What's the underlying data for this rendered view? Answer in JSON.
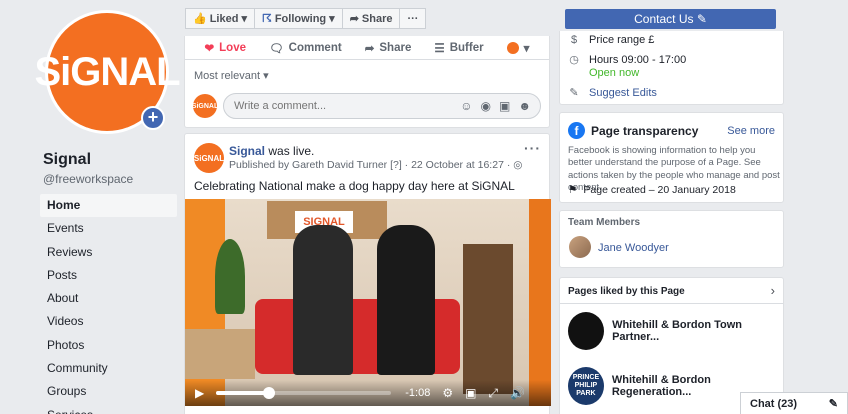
{
  "profile": {
    "logo_text": "SiGNAL",
    "name": "Signal",
    "handle": "@freeworkspace"
  },
  "nav": {
    "items": [
      {
        "label": "Home",
        "active": true
      },
      {
        "label": "Events"
      },
      {
        "label": "Reviews"
      },
      {
        "label": "Posts"
      },
      {
        "label": "About"
      },
      {
        "label": "Videos"
      },
      {
        "label": "Photos"
      },
      {
        "label": "Community"
      },
      {
        "label": "Groups"
      },
      {
        "label": "Services"
      }
    ]
  },
  "action_bar": {
    "liked": "Liked",
    "following": "Following",
    "share": "Share",
    "more": "···"
  },
  "top_post": {
    "love": "Love",
    "comment": "Comment",
    "share": "Share",
    "buffer": "Buffer",
    "sort": "Most relevant",
    "comment_placeholder": "Write a comment..."
  },
  "post": {
    "author": "Signal",
    "author_suffix": "was live.",
    "meta": "Published by Gareth David Turner [?] · 22 October at 16:27 · ◎",
    "text": "Celebrating National make a dog happy day here at SiGNAL",
    "video_sign": "SIGNAL",
    "video": {
      "progress": 0.3,
      "time_remaining": "-1:08"
    }
  },
  "right": {
    "contact_button": "Contact Us ✎",
    "price_range": "Price range £",
    "hours": "Hours 09:00 - 17:00",
    "open_now": "Open now",
    "suggest_edits": "Suggest Edits",
    "transparency": {
      "title": "Page transparency",
      "see_more": "See more",
      "description": "Facebook is showing information to help you better understand the purpose of a Page. See actions taken by the people who manage and post content.",
      "created": "Page created – 20 January 2018"
    },
    "team": {
      "title": "Team Members",
      "member": "Jane Woodyer"
    },
    "liked_pages": {
      "title": "Pages liked by this Page",
      "items": [
        {
          "name": "Whitehill & Bordon Town Partner...",
          "thumb": ""
        },
        {
          "name": "Whitehill & Bordon Regeneration...",
          "thumb": "PRINCE PHILIP PARK"
        }
      ]
    }
  },
  "chat": {
    "label": "Chat (23)"
  }
}
